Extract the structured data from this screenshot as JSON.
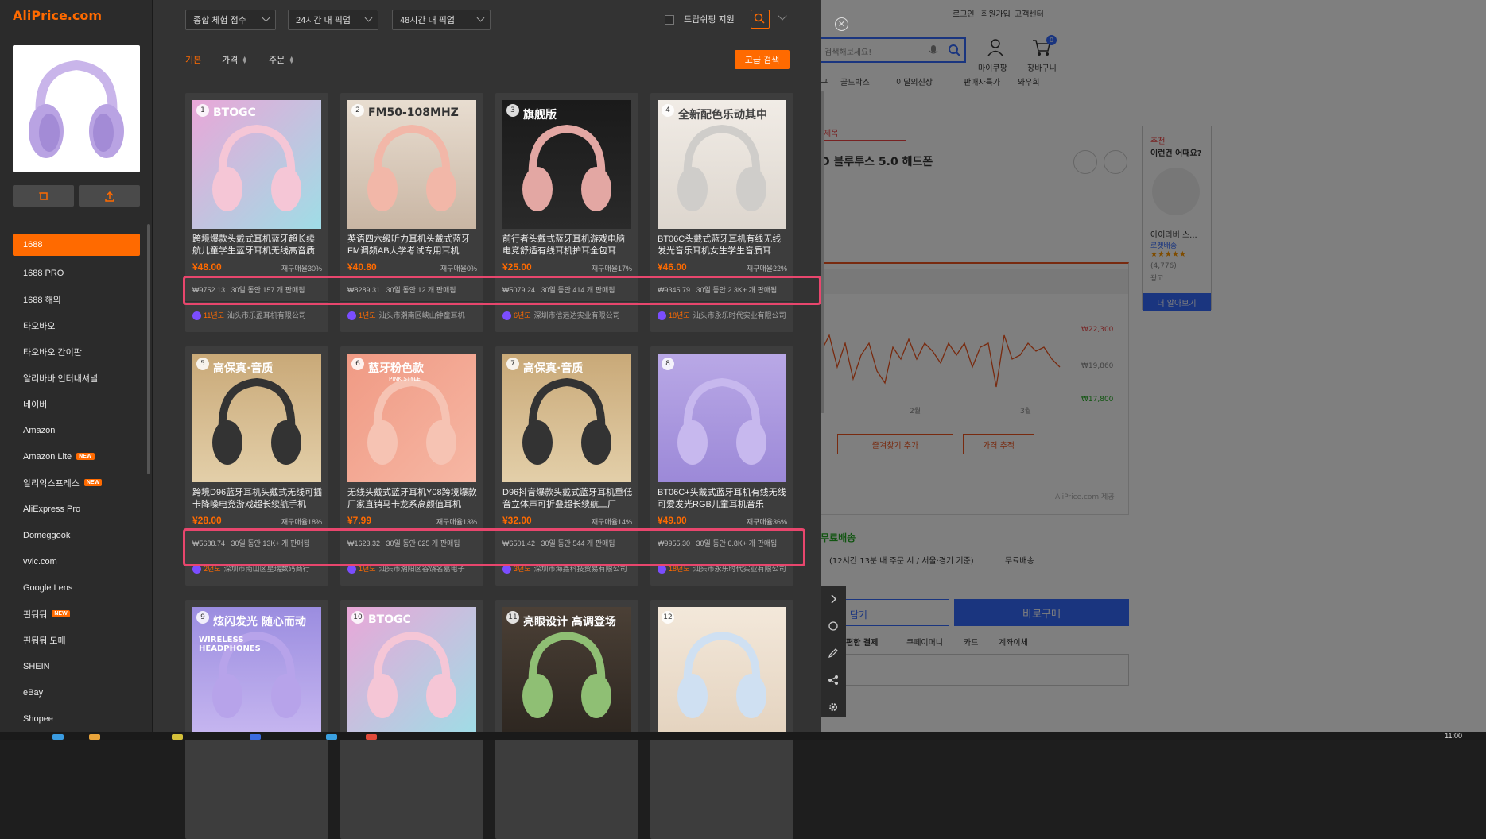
{
  "app": {
    "logo": "AliPrice.com"
  },
  "background_page": {
    "top_links": [
      "로그인",
      "회원가입",
      "고객센터"
    ],
    "search_placeholder": "검색해보세요!",
    "mypage": "마이쿠팡",
    "cart": "장바구니",
    "cart_count": "0",
    "nav_items": [
      "골드박스",
      "이달의신상",
      "판매자특가",
      "와우회"
    ],
    "nav_prefix": "구",
    "product_title_fragment": "D 블루투스 5.0 헤드폰",
    "title_prefix": "제목",
    "recommend_label": "추천",
    "recommend_title": "이런건 어때요?",
    "recommend_item": "아이리버 스...",
    "recommend_badge": "로켓배송",
    "recommend_reviews": "(4,776)",
    "recommend_ad": "광고",
    "more_button": "더 알아보기",
    "chart_prices": [
      "₩22,300",
      "₩19,860",
      "₩17,800"
    ],
    "chart_months": [
      "2월",
      "3월"
    ],
    "favorite_button": "즐겨찾기 추가",
    "price_track_button": "가격 추적",
    "aliprice_credit": "AliPrice.com 제공",
    "free_shipping": "무료배송",
    "delivery_info": "(12시간 13분  내 주문 시 / 서울·경기 기준)",
    "free_shipping2": "무료배송",
    "cart_button": "구니 담기",
    "buy_button": "바로구매",
    "payment_label": "편한 결제",
    "payment_methods": [
      "쿠페이머니",
      "카드",
      "계좌이체"
    ],
    "payment_prefix": "∫"
  },
  "left_panel": {
    "sources": [
      {
        "label": "1688",
        "active": true,
        "new": false
      },
      {
        "label": "1688 PRO",
        "active": false,
        "new": false
      },
      {
        "label": "1688 해외",
        "active": false,
        "new": false
      },
      {
        "label": "타오바오",
        "active": false,
        "new": false
      },
      {
        "label": "타오바오 간이판",
        "active": false,
        "new": false
      },
      {
        "label": "알리바바 인터내셔널",
        "active": false,
        "new": false
      },
      {
        "label": "네이버",
        "active": false,
        "new": false
      },
      {
        "label": "Amazon",
        "active": false,
        "new": false
      },
      {
        "label": "Amazon Lite",
        "active": false,
        "new": true
      },
      {
        "label": "알리익스프레스",
        "active": false,
        "new": true
      },
      {
        "label": "AliExpress Pro",
        "active": false,
        "new": false
      },
      {
        "label": "Domeggook",
        "active": false,
        "new": false
      },
      {
        "label": "vvic.com",
        "active": false,
        "new": false
      },
      {
        "label": "Google Lens",
        "active": false,
        "new": false
      },
      {
        "label": "핀둬둬",
        "active": false,
        "new": true
      },
      {
        "label": "핀둬둬 도매",
        "active": false,
        "new": false
      },
      {
        "label": "SHEIN",
        "active": false,
        "new": false
      },
      {
        "label": "eBay",
        "active": false,
        "new": false
      },
      {
        "label": "Shopee",
        "active": false,
        "new": false
      }
    ],
    "new_badge": "NEW"
  },
  "filters": {
    "score": "종합 체험 점수",
    "pickup24": "24시간 내 픽업",
    "pickup48": "48시간 내 픽업",
    "dropship": "드랍쉬핑 지원"
  },
  "sort_tabs": [
    "기본",
    "가격",
    "주문"
  ],
  "advanced_search": "고급 검색",
  "products": [
    {
      "num": "1",
      "title": "跨境爆款头戴式耳机蓝牙超长续航儿童学生蓝牙耳机无线高音质",
      "price": "¥48.00",
      "repurchase": "재구매율30%",
      "gmv": "₩9752.13",
      "sold": "30일 동안 157 개 판매됨",
      "years": "11년도",
      "shop": "汕头市乐盈耳机有限公司"
    },
    {
      "num": "2",
      "title": "英语四六级听力耳机头戴式蓝牙FM调频AB大学考试专用耳机",
      "price": "¥40.80",
      "repurchase": "재구매율0%",
      "gmv": "₩8289.31",
      "sold": "30일 동안 12 개 판매됨",
      "years": "1년도",
      "shop": "汕头市潮南区峡山钟童耳机"
    },
    {
      "num": "3",
      "title": "前行者头戴式蓝牙耳机游戏电脑电竞舒适有线耳机护耳全包耳",
      "price": "¥25.00",
      "repurchase": "재구매율17%",
      "gmv": "₩5079.24",
      "sold": "30일 동안 414 개 판매됨",
      "years": "6년도",
      "shop": "深圳市信远达实业有限公司"
    },
    {
      "num": "4",
      "title": "BT06C头戴式蓝牙耳机有线无线发光音乐耳机女生学生音质耳",
      "price": "¥46.00",
      "repurchase": "재구매율22%",
      "gmv": "₩9345.79",
      "sold": "30일 동안 2.3K+ 개 판매됨",
      "years": "18년도",
      "shop": "汕头市永乐时代实业有限公司"
    },
    {
      "num": "5",
      "title": "跨境D96蓝牙耳机头戴式无线可插卡降噪电竞游戏超长续航手机",
      "price": "¥28.00",
      "repurchase": "재구매율18%",
      "gmv": "₩5688.74",
      "sold": "30일 동안 13K+ 개 판매됨",
      "years": "2년도",
      "shop": "深圳市南山区星瑞数码商行"
    },
    {
      "num": "6",
      "title": "无线头戴式蓝牙耳机Y08跨境爆款厂家直销马卡龙系高颜值耳机",
      "price": "¥7.99",
      "repurchase": "재구매율13%",
      "gmv": "₩1623.32",
      "sold": "30일 동안 625 개 판매됨",
      "years": "1년도",
      "shop": "汕头市潮阳区谷饶名嘉电子"
    },
    {
      "num": "7",
      "title": "D96抖音爆款头戴式蓝牙耳机重低音立体声可折叠超长续航工厂",
      "price": "¥32.00",
      "repurchase": "재구매율14%",
      "gmv": "₩6501.42",
      "sold": "30일 동안 544 개 판매됨",
      "years": "3년도",
      "shop": "深圳市海鑫科技贸易有限公司"
    },
    {
      "num": "8",
      "title": "BT06C+头戴式蓝牙耳机有线无线可爱发光RGB儿童耳机音乐",
      "price": "¥49.00",
      "repurchase": "재구매율36%",
      "gmv": "₩9955.30",
      "sold": "30일 동안 6.8K+ 개 판매됨",
      "years": "18년도",
      "shop": "汕头市永乐时代实业有限公司"
    },
    {
      "num": "9",
      "title": "",
      "price": "",
      "repurchase": "",
      "gmv": "",
      "sold": "",
      "years": "",
      "shop": ""
    },
    {
      "num": "10",
      "title": "",
      "price": "",
      "repurchase": "",
      "gmv": "",
      "sold": "",
      "years": "",
      "shop": ""
    },
    {
      "num": "11",
      "title": "",
      "price": "",
      "repurchase": "",
      "gmv": "",
      "sold": "",
      "years": "",
      "shop": ""
    },
    {
      "num": "12",
      "title": "",
      "price": "",
      "repurchase": "",
      "gmv": "",
      "sold": "",
      "years": "",
      "shop": ""
    }
  ],
  "thumb_text": {
    "p1": "BTOGC",
    "p2": "FM50-108MHZ",
    "p3": "旗舰版",
    "p4": "全新配色乐动其中",
    "p5": "高保真·音质",
    "p6": "蓝牙粉色款",
    "p6sub": "PINK STYLE",
    "p7": "高保真·音质",
    "p9": "炫闪发光 随心而动",
    "p9sub": "WIRELESS HEADPHONES",
    "p10": "BTOGC",
    "p11": "亮眼设计 高调登场"
  },
  "clock": "11:00",
  "colors": {
    "accent": "#ff6a00",
    "highlight": "#e8466d",
    "panel": "#333333",
    "card": "#3d3d3d"
  }
}
